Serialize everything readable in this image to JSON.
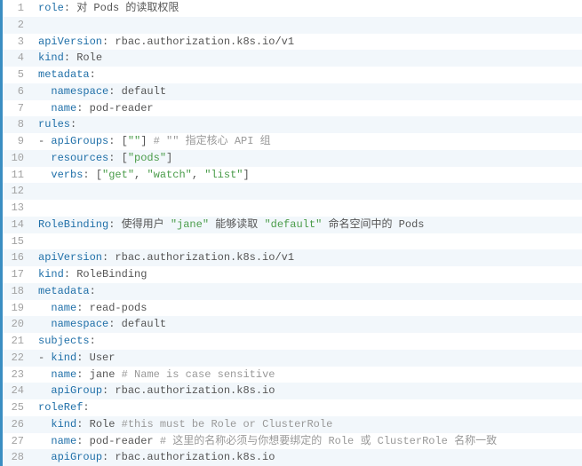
{
  "lines": [
    {
      "tokens": [
        {
          "t": "role",
          "c": "key"
        },
        {
          "t": ": 对 Pods 的读取权限",
          "c": "plain"
        }
      ]
    },
    {
      "tokens": []
    },
    {
      "tokens": [
        {
          "t": "apiVersion",
          "c": "key"
        },
        {
          "t": ": rbac.authorization.k8s.io/v1",
          "c": "plain"
        }
      ]
    },
    {
      "tokens": [
        {
          "t": "kind",
          "c": "key"
        },
        {
          "t": ": Role",
          "c": "plain"
        }
      ]
    },
    {
      "tokens": [
        {
          "t": "metadata",
          "c": "key"
        },
        {
          "t": ":",
          "c": "plain"
        }
      ]
    },
    {
      "tokens": [
        {
          "t": "  ",
          "c": "plain"
        },
        {
          "t": "namespace",
          "c": "key"
        },
        {
          "t": ": default",
          "c": "plain"
        }
      ]
    },
    {
      "tokens": [
        {
          "t": "  ",
          "c": "plain"
        },
        {
          "t": "name",
          "c": "key"
        },
        {
          "t": ": pod-reader",
          "c": "plain"
        }
      ]
    },
    {
      "tokens": [
        {
          "t": "rules",
          "c": "key"
        },
        {
          "t": ":",
          "c": "plain"
        }
      ]
    },
    {
      "tokens": [
        {
          "t": "- ",
          "c": "plain"
        },
        {
          "t": "apiGroups",
          "c": "key"
        },
        {
          "t": ": [",
          "c": "plain"
        },
        {
          "t": "\"\"",
          "c": "str"
        },
        {
          "t": "] ",
          "c": "plain"
        },
        {
          "t": "# \"\" 指定核心 API 组",
          "c": "com"
        }
      ]
    },
    {
      "tokens": [
        {
          "t": "  ",
          "c": "plain"
        },
        {
          "t": "resources",
          "c": "key"
        },
        {
          "t": ": [",
          "c": "plain"
        },
        {
          "t": "\"pods\"",
          "c": "str"
        },
        {
          "t": "]",
          "c": "plain"
        }
      ]
    },
    {
      "tokens": [
        {
          "t": "  ",
          "c": "plain"
        },
        {
          "t": "verbs",
          "c": "key"
        },
        {
          "t": ": [",
          "c": "plain"
        },
        {
          "t": "\"get\"",
          "c": "str"
        },
        {
          "t": ", ",
          "c": "plain"
        },
        {
          "t": "\"watch\"",
          "c": "str"
        },
        {
          "t": ", ",
          "c": "plain"
        },
        {
          "t": "\"list\"",
          "c": "str"
        },
        {
          "t": "]",
          "c": "plain"
        }
      ]
    },
    {
      "tokens": []
    },
    {
      "tokens": []
    },
    {
      "tokens": [
        {
          "t": "RoleBinding",
          "c": "key"
        },
        {
          "t": ": 使得用户 ",
          "c": "plain"
        },
        {
          "t": "\"jane\"",
          "c": "str"
        },
        {
          "t": " 能够读取 ",
          "c": "plain"
        },
        {
          "t": "\"default\"",
          "c": "str"
        },
        {
          "t": " 命名空间中的 Pods",
          "c": "plain"
        }
      ]
    },
    {
      "tokens": []
    },
    {
      "tokens": [
        {
          "t": "apiVersion",
          "c": "key"
        },
        {
          "t": ": rbac.authorization.k8s.io/v1",
          "c": "plain"
        }
      ]
    },
    {
      "tokens": [
        {
          "t": "kind",
          "c": "key"
        },
        {
          "t": ": RoleBinding",
          "c": "plain"
        }
      ]
    },
    {
      "tokens": [
        {
          "t": "metadata",
          "c": "key"
        },
        {
          "t": ":",
          "c": "plain"
        }
      ]
    },
    {
      "tokens": [
        {
          "t": "  ",
          "c": "plain"
        },
        {
          "t": "name",
          "c": "key"
        },
        {
          "t": ": read-pods",
          "c": "plain"
        }
      ]
    },
    {
      "tokens": [
        {
          "t": "  ",
          "c": "plain"
        },
        {
          "t": "namespace",
          "c": "key"
        },
        {
          "t": ": default",
          "c": "plain"
        }
      ]
    },
    {
      "tokens": [
        {
          "t": "subjects",
          "c": "key"
        },
        {
          "t": ":",
          "c": "plain"
        }
      ]
    },
    {
      "tokens": [
        {
          "t": "- ",
          "c": "plain"
        },
        {
          "t": "kind",
          "c": "key"
        },
        {
          "t": ": User",
          "c": "plain"
        }
      ]
    },
    {
      "tokens": [
        {
          "t": "  ",
          "c": "plain"
        },
        {
          "t": "name",
          "c": "key"
        },
        {
          "t": ": jane ",
          "c": "plain"
        },
        {
          "t": "# Name is case sensitive",
          "c": "com"
        }
      ]
    },
    {
      "tokens": [
        {
          "t": "  ",
          "c": "plain"
        },
        {
          "t": "apiGroup",
          "c": "key"
        },
        {
          "t": ": rbac.authorization.k8s.io",
          "c": "plain"
        }
      ]
    },
    {
      "tokens": [
        {
          "t": "roleRef",
          "c": "key"
        },
        {
          "t": ":",
          "c": "plain"
        }
      ]
    },
    {
      "tokens": [
        {
          "t": "  ",
          "c": "plain"
        },
        {
          "t": "kind",
          "c": "key"
        },
        {
          "t": ": Role ",
          "c": "plain"
        },
        {
          "t": "#this must be Role or ClusterRole",
          "c": "com"
        }
      ]
    },
    {
      "tokens": [
        {
          "t": "  ",
          "c": "plain"
        },
        {
          "t": "name",
          "c": "key"
        },
        {
          "t": ": pod-reader ",
          "c": "plain"
        },
        {
          "t": "# 这里的名称必须与你想要绑定的 Role 或 ClusterRole 名称一致",
          "c": "com"
        }
      ]
    },
    {
      "tokens": [
        {
          "t": "  ",
          "c": "plain"
        },
        {
          "t": "apiGroup",
          "c": "key"
        },
        {
          "t": ": rbac.authorization.k8s.io",
          "c": "plain"
        }
      ]
    }
  ]
}
